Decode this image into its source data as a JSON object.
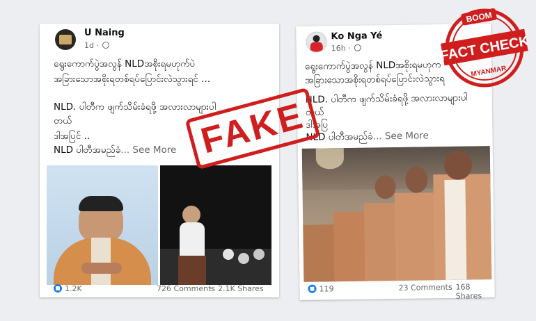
{
  "post1": {
    "author": "U Naing",
    "time": "1d",
    "line1": "ရွေးကောက်ပွဲအလွန် NLDအစိုးရမဟုက်ပဲ",
    "line2": "အခြားသောအစိုးရတစ်ရပ်ပြောင်းလဲသွားရင် ...",
    "line3": "NLD. ပါတီက ဖျက်သိမ်းခံရဖို့ အလားလာများပါ",
    "line4": "တယ်",
    "line5": "ဒါအပြင် ..",
    "line6": "NLD ပါတီအမည်ခံ",
    "see_more": "... See More",
    "likes": "1.2K",
    "comments": "726 Comments",
    "shares": "2.1K Shares"
  },
  "post2": {
    "author": "Ko Nga Yé",
    "time": "16h",
    "line1": "ရွေးကောက်ပွဲအလွန် NLDအစိုးရမဟုက",
    "line2": "အခြားသောအစိုးရတစ်ရပ်ပြောင်းလဲသွားရ",
    "line3": "NLD. ပါတီက ဖျက်သိမ်းခံရဖို့ အလားလာများပါ",
    "line4": "တယ်",
    "line5": "ဒါအပြ",
    "line6": "NLD ပါတီအမည်ခံ",
    "see_more": "... See More",
    "likes": "119",
    "comments": "23 Comments",
    "shares": "168 Shares"
  },
  "overlay": {
    "fake": "FAKE",
    "brand_top": "BOOM",
    "brand_main": "FACT CHECK",
    "brand_bottom": "MYANMAR"
  },
  "colors": {
    "like": "#1877f2",
    "stamp_red": "#d01e1e"
  }
}
